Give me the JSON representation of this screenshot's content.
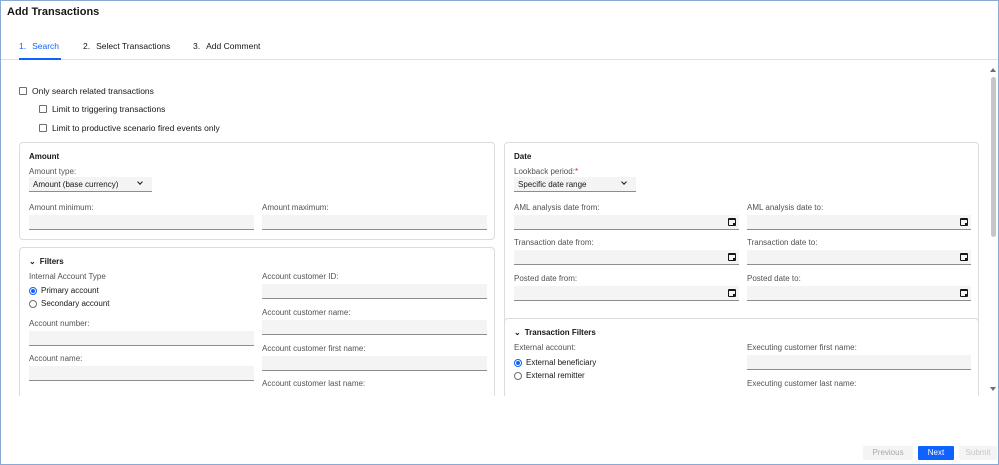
{
  "dialog": {
    "title": "Add Transactions"
  },
  "tabs": [
    {
      "num": "1.",
      "label": "Search"
    },
    {
      "num": "2.",
      "label": "Select Transactions"
    },
    {
      "num": "3.",
      "label": "Add Comment"
    }
  ],
  "options": {
    "only_related": "Only search related transactions",
    "limit_triggering": "Limit to triggering transactions",
    "limit_productive": "Limit to productive scenario fired events only"
  },
  "amount": {
    "title": "Amount",
    "type_label": "Amount type:",
    "type_value": "Amount (base currency)",
    "min_label": "Amount minimum:",
    "max_label": "Amount maximum:"
  },
  "date": {
    "title": "Date",
    "lookback_label": "Lookback period:",
    "required_mark": "*",
    "lookback_value": "Specific date range",
    "aml_from": "AML analysis date from:",
    "aml_to": "AML analysis date to:",
    "tx_from": "Transaction date from:",
    "tx_to": "Transaction date to:",
    "posted_from": "Posted date from:",
    "posted_to": "Posted date to:"
  },
  "filters": {
    "title": "Filters",
    "internal_type_label": "Internal Account Type",
    "primary": "Primary account",
    "secondary": "Secondary account",
    "account_number": "Account number:",
    "account_name": "Account name:",
    "cust_id": "Account customer ID:",
    "cust_name": "Account customer name:",
    "cust_first": "Account customer first name:",
    "cust_last": "Account customer last name:"
  },
  "tx_filters": {
    "title": "Transaction Filters",
    "external_label": "External account:",
    "beneficiary": "External beneficiary",
    "remitter": "External remitter",
    "exec_first": "Executing customer first name:",
    "exec_last": "Executing customer last name:"
  },
  "buttons": {
    "previous": "Previous",
    "next": "Next",
    "submit": "Submit"
  },
  "colors": {
    "accent": "#0f62fe",
    "required": "#da1e28"
  }
}
